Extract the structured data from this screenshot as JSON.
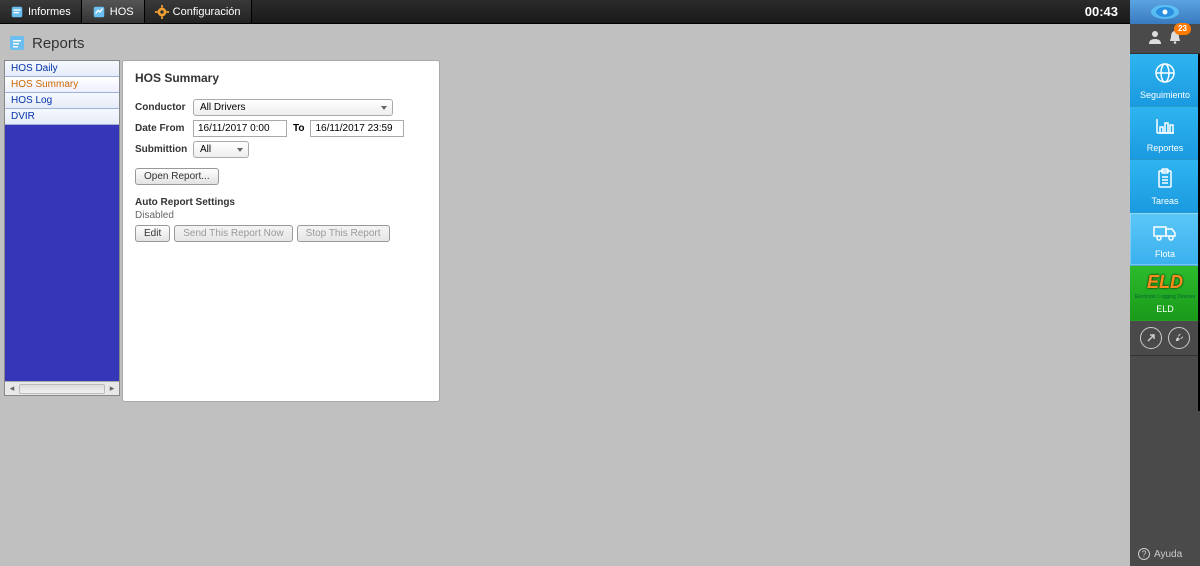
{
  "top": {
    "tabs": [
      {
        "label": "Informes",
        "icon": "reports"
      },
      {
        "label": "HOS",
        "icon": "hos"
      },
      {
        "label": "Configuración",
        "icon": "gear"
      }
    ],
    "time": "00:43"
  },
  "page": {
    "title": "Reports"
  },
  "sidebar_list": {
    "items": [
      "HOS Daily",
      "HOS Summary",
      "HOS Log",
      "DVIR"
    ],
    "selected_index": 1
  },
  "panel": {
    "title": "HOS Summary",
    "labels": {
      "conductor": "Conductor",
      "date_from": "Date From",
      "to": "To",
      "submission": "Submittion",
      "auto_report": "Auto Report Settings",
      "disabled": "Disabled"
    },
    "values": {
      "conductor": "All Drivers",
      "date_from": "16/11/2017 0:00",
      "date_to": "16/11/2017 23:59",
      "submission": "All"
    },
    "buttons": {
      "open_report": "Open Report...",
      "edit": "Edit",
      "send_now": "Send This Report Now",
      "stop": "Stop This Report"
    }
  },
  "ribbon": {
    "notif_count": "23",
    "items": {
      "seguimiento": "Seguimiento",
      "reportes": "Reportes",
      "tareas": "Tareas",
      "flota": "Flota",
      "eld_logo": "ELD",
      "eld_sub": "Electronic Logging Devices",
      "eld_label": "ELD"
    },
    "help": "Ayuda"
  }
}
